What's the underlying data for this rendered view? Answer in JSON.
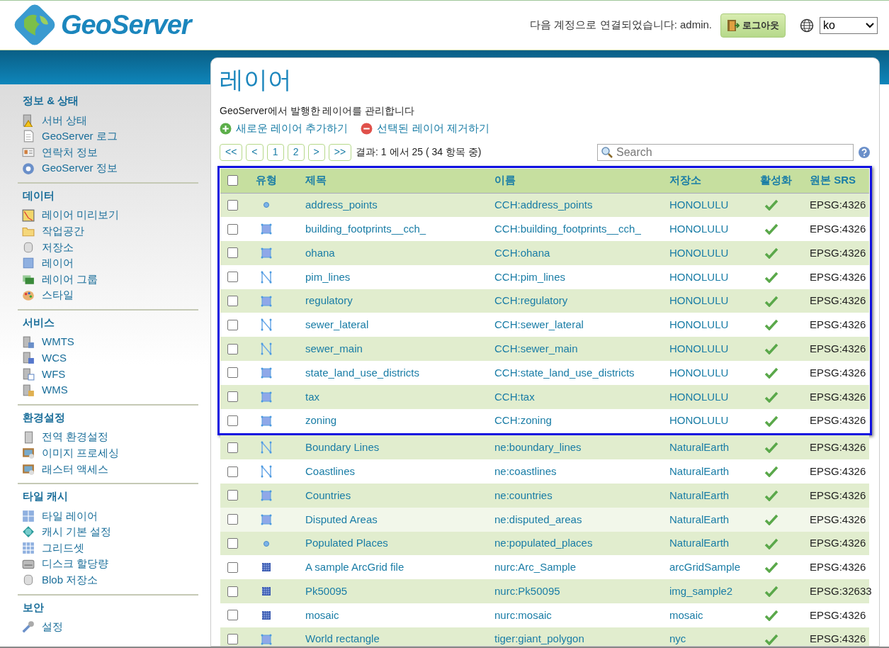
{
  "header": {
    "logo_text": "GeoServer",
    "login_status": "다음 계정으로 연결되었습니다: admin.",
    "logout_button": "로그아웃",
    "language": "ko"
  },
  "sidebar": {
    "sections": [
      {
        "title": "정보 & 상태",
        "items": [
          "서버 상태",
          "GeoServer 로그",
          "연락처 정보",
          "GeoServer 정보"
        ]
      },
      {
        "title": "데이터",
        "items": [
          "레이어 미리보기",
          "작업공간",
          "저장소",
          "레이어",
          "레이어 그룹",
          "스타일"
        ]
      },
      {
        "title": "서비스",
        "items": [
          "WMTS",
          "WCS",
          "WFS",
          "WMS"
        ]
      },
      {
        "title": "환경설정",
        "items": [
          "전역 환경설정",
          "이미지 프로세싱",
          "래스터 액세스"
        ]
      },
      {
        "title": "타일 캐시",
        "items": [
          "타일 레이어",
          "캐시 기본 설정",
          "그리드셋",
          "디스크 할당량",
          "Blob 저장소"
        ]
      },
      {
        "title": "보안",
        "items": [
          "설정"
        ]
      }
    ]
  },
  "page": {
    "title": "레이어",
    "description": "GeoServer에서 발행한 레이어를 관리합니다",
    "actions": [
      {
        "kind": "add",
        "label": "새로운 레이어 추가하기"
      },
      {
        "kind": "remove",
        "label": "선택된 레이어 제거하기"
      }
    ]
  },
  "pager": {
    "buttons": [
      {
        "label": "<<"
      },
      {
        "label": "<"
      },
      {
        "label": "1"
      },
      {
        "label": "2"
      },
      {
        "label": ">"
      },
      {
        "label": ">>"
      }
    ],
    "results": "결과: 1 에서 25 ( 34 항목 중)",
    "search_placeholder": "Search"
  },
  "table": {
    "columns": [
      "유형",
      "제목",
      "이름",
      "저장소",
      "활성화",
      "원본 **SRS**"
    ],
    "header_checked": false,
    "rows": [
      {
        "kind": "point",
        "title": "address_points",
        "name": "CCH:address_points",
        "store": "HONOLULU",
        "enabled": true,
        "srs": "EPSG:4326",
        "checked": false,
        "outlined": true,
        "highlighted": false
      },
      {
        "kind": "polygon",
        "title": "building_footprints__cch_",
        "name": "CCH:building_footprints__cch_",
        "store": "HONOLULU",
        "enabled": true,
        "srs": "EPSG:4326",
        "checked": false,
        "outlined": true,
        "highlighted": false
      },
      {
        "kind": "polygon",
        "title": "ohana",
        "name": "CCH:ohana",
        "store": "HONOLULU",
        "enabled": true,
        "srs": "EPSG:4326",
        "checked": false,
        "outlined": true,
        "highlighted": false
      },
      {
        "kind": "line",
        "title": "pim_lines",
        "name": "CCH:pim_lines",
        "store": "HONOLULU",
        "enabled": true,
        "srs": "EPSG:4326",
        "checked": false,
        "outlined": true,
        "highlighted": false
      },
      {
        "kind": "polygon",
        "title": "regulatory",
        "name": "CCH:regulatory",
        "store": "HONOLULU",
        "enabled": true,
        "srs": "EPSG:4326",
        "checked": false,
        "outlined": true,
        "highlighted": false
      },
      {
        "kind": "line",
        "title": "sewer_lateral",
        "name": "CCH:sewer_lateral",
        "store": "HONOLULU",
        "enabled": true,
        "srs": "EPSG:4326",
        "checked": false,
        "outlined": true,
        "highlighted": false
      },
      {
        "kind": "line",
        "title": "sewer_main",
        "name": "CCH:sewer_main",
        "store": "HONOLULU",
        "enabled": true,
        "srs": "EPSG:4326",
        "checked": false,
        "outlined": true,
        "highlighted": false
      },
      {
        "kind": "polygon",
        "title": "state_land_use_districts",
        "name": "CCH:state_land_use_districts",
        "store": "HONOLULU",
        "enabled": true,
        "srs": "EPSG:4326",
        "checked": false,
        "outlined": true,
        "highlighted": false
      },
      {
        "kind": "polygon",
        "title": "tax",
        "name": "CCH:tax",
        "store": "HONOLULU",
        "enabled": true,
        "srs": "EPSG:4326",
        "checked": false,
        "outlined": true,
        "highlighted": false
      },
      {
        "kind": "polygon",
        "title": "zoning",
        "name": "CCH:zoning",
        "store": "HONOLULU",
        "enabled": true,
        "srs": "EPSG:4326",
        "checked": false,
        "outlined": true,
        "highlighted": false
      },
      {
        "kind": "line",
        "title": "Boundary Lines",
        "name": "ne:boundary_lines",
        "store": "NaturalEarth",
        "enabled": true,
        "srs": "EPSG:4326",
        "checked": false,
        "outlined": false,
        "highlighted": false
      },
      {
        "kind": "line",
        "title": "Coastlines",
        "name": "ne:coastlines",
        "store": "NaturalEarth",
        "enabled": true,
        "srs": "EPSG:4326",
        "checked": false,
        "outlined": false,
        "highlighted": false
      },
      {
        "kind": "polygon",
        "title": "Countries",
        "name": "ne:countries",
        "store": "NaturalEarth",
        "enabled": true,
        "srs": "EPSG:4326",
        "checked": false,
        "outlined": false,
        "highlighted": false
      },
      {
        "kind": "polygon",
        "title": "Disputed Areas",
        "name": "ne:disputed_areas",
        "store": "NaturalEarth",
        "enabled": true,
        "srs": "EPSG:4326",
        "checked": false,
        "outlined": false,
        "highlighted": true
      },
      {
        "kind": "point",
        "title": "Populated Places",
        "name": "ne:populated_places",
        "store": "NaturalEarth",
        "enabled": true,
        "srs": "EPSG:4326",
        "checked": false,
        "outlined": false,
        "highlighted": false
      },
      {
        "kind": "raster",
        "title": "A sample ArcGrid file",
        "name": "nurc:Arc_Sample",
        "store": "arcGridSample",
        "enabled": true,
        "srs": "EPSG:4326",
        "checked": false,
        "outlined": false,
        "highlighted": false
      },
      {
        "kind": "raster",
        "title": "Pk50095",
        "name": "nurc:Pk50095",
        "store": "img_sample2",
        "enabled": true,
        "srs": "EPSG:32633",
        "checked": false,
        "outlined": false,
        "highlighted": false
      },
      {
        "kind": "raster",
        "title": "mosaic",
        "name": "nurc:mosaic",
        "store": "mosaic",
        "enabled": true,
        "srs": "EPSG:4326",
        "checked": false,
        "outlined": false,
        "highlighted": false
      },
      {
        "kind": "polygon",
        "title": "World rectangle",
        "name": "tiger:giant_polygon",
        "store": "nyc",
        "enabled": true,
        "srs": "EPSG:4326",
        "checked": false,
        "outlined": false,
        "highlighted": false
      }
    ]
  }
}
